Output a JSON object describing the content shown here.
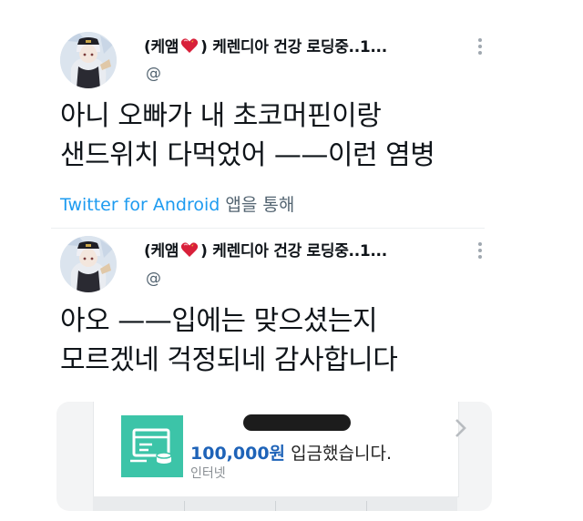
{
  "tweets": [
    {
      "display_name_prefix": "(케앰",
      "display_name_suffix": ") 케렌디아 건강 로딩중..1...",
      "handle": "@",
      "text_lines": [
        "아니 오빠가 내 초코머핀이랑",
        "샌드위치 다먹었어 ——이런 염병"
      ],
      "source_link": "Twitter for Android",
      "source_suffix": " 앱을 통해"
    },
    {
      "display_name_prefix": "(케앰",
      "display_name_suffix": ") 케렌디아 건강 로딩중..1...",
      "handle": "@",
      "text_lines": [
        "아오 ——입에는 맞으셨는지",
        "모르겠네 걱정되네 감사합니다"
      ]
    }
  ],
  "bank_notice": {
    "amount": "100,000원",
    "message": " 입금했습니다.",
    "channel": "인터넷"
  },
  "colors": {
    "link": "#1d9bf0",
    "heart": "#d8203a",
    "bank_icon_bg": "#3cc4a8",
    "amount": "#1e63b8"
  },
  "icons": {
    "heart": "heart-icon",
    "more": "more-vertical-icon",
    "bank": "bank-transfer-icon",
    "chevron": "chevron-right-icon"
  }
}
